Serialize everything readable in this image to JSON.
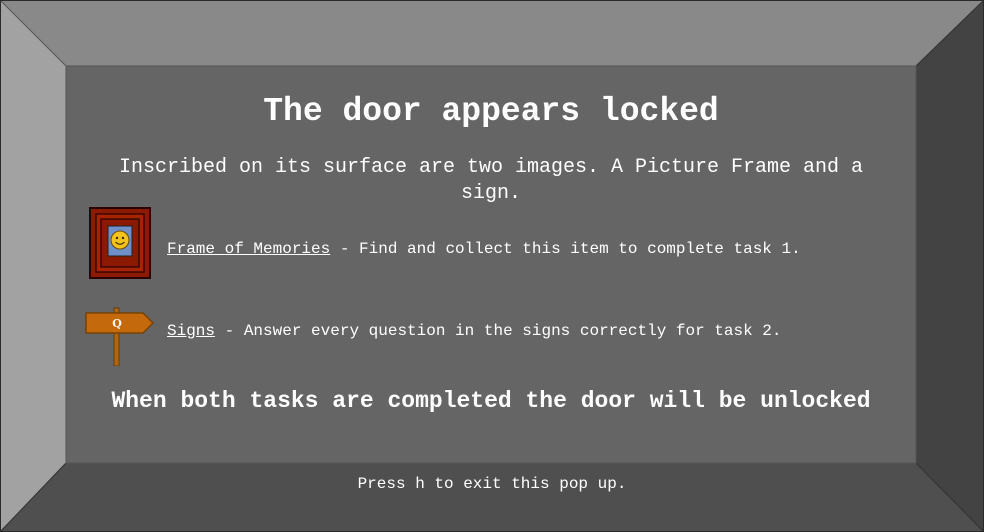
{
  "popup": {
    "title": "The door appears locked",
    "intro": "Inscribed on its surface are two images. A Picture Frame and a sign.",
    "tasks": [
      {
        "icon": "picture-frame-icon",
        "name": "Frame of Memories",
        "description": " - Find and collect this item to complete task 1."
      },
      {
        "icon": "signpost-icon",
        "sign_letter": "Q",
        "name": "Signs",
        "description": " - Answer every question in the signs correctly for task 2."
      }
    ],
    "final_message": "When both tasks are completed the door will be unlocked",
    "exit_hint": "Press h to exit this pop up."
  },
  "colors": {
    "panel": "#656565",
    "bevel_top": "#898989",
    "bevel_left": "#a2a2a2",
    "bevel_right": "#434343",
    "bevel_bottom": "#4f4f4f",
    "frame_red": "#8b1a00",
    "sign_orange": "#c56a0c"
  }
}
